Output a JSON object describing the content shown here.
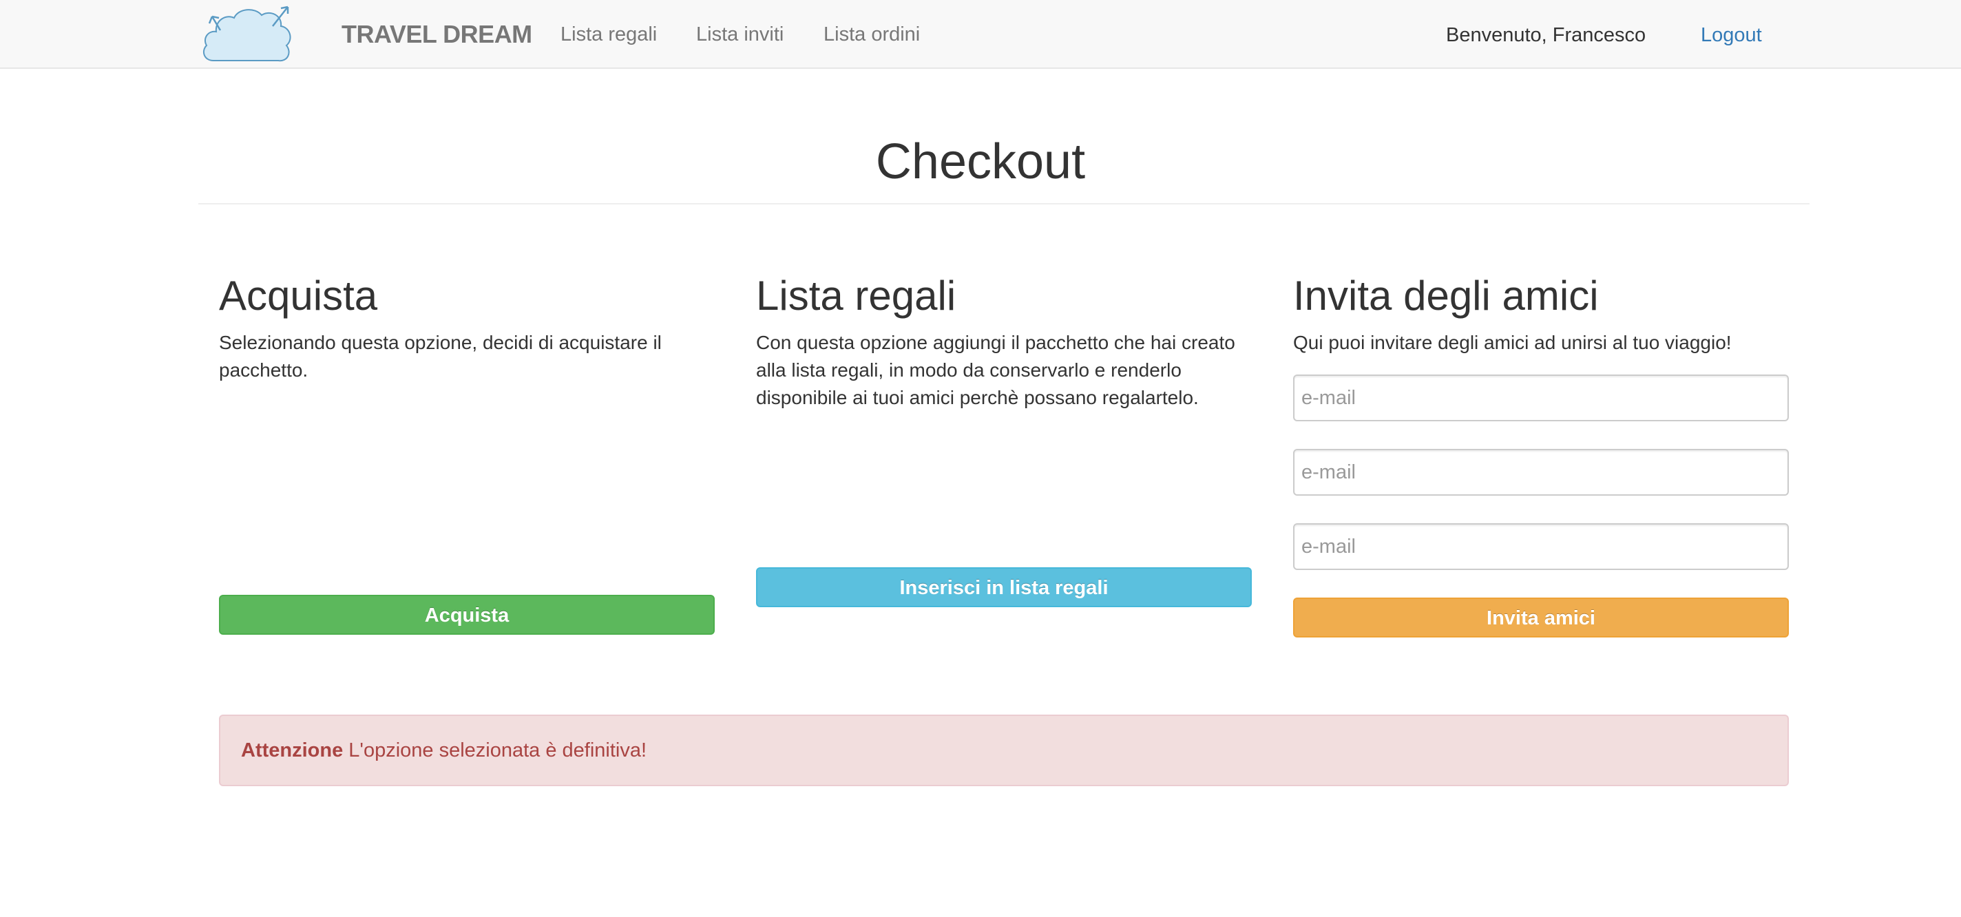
{
  "navbar": {
    "brand": "TRAVEL DREAM",
    "links": [
      "Lista regali",
      "Lista inviti",
      "Lista ordini"
    ],
    "welcome": "Benvenuto, Francesco",
    "logout": "Logout"
  },
  "page": {
    "title": "Checkout"
  },
  "columns": {
    "buy": {
      "heading": "Acquista",
      "text": "Selezionando questa opzione, decidi di acquistare il pacchetto.",
      "button": "Acquista"
    },
    "gift_list": {
      "heading": "Lista regali",
      "text": "Con questa opzione aggiungi il pacchetto che hai creato alla lista regali, in modo da conservarlo e renderlo disponibile ai tuoi amici perchè possano regalartelo.",
      "button": "Inserisci in lista regali"
    },
    "invite": {
      "heading": "Invita degli amici",
      "text": "Qui puoi invitare degli amici ad unirsi al tuo viaggio!",
      "email_placeholder": "e-mail",
      "button": "Invita amici"
    }
  },
  "alert": {
    "strong": "Attenzione",
    "message": "L'opzione selezionata è definitiva!"
  },
  "colors": {
    "success": "#5cb85c",
    "info": "#5bc0de",
    "warning": "#f0ad4e",
    "danger_text": "#a94442",
    "danger_bg": "#f2dede",
    "link": "#337ab7"
  }
}
